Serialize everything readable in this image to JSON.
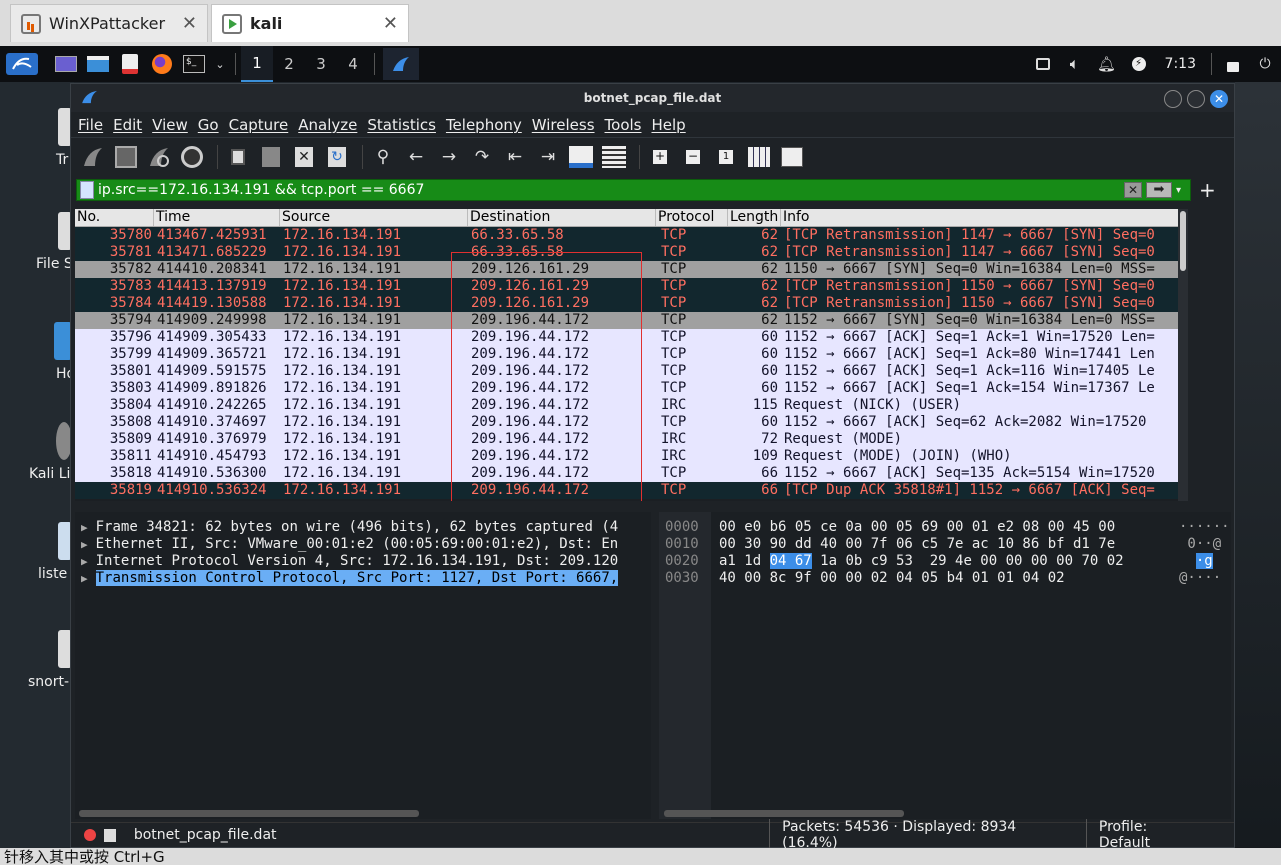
{
  "host_tabs": [
    {
      "label": "WinXPattacker",
      "close": "✕"
    },
    {
      "label": "kali",
      "close": "✕"
    }
  ],
  "panel": {
    "workspaces": [
      "1",
      "2",
      "3",
      "4"
    ],
    "active_workspace": "1",
    "clock": "7:13"
  },
  "desktop_icons": [
    "Tr",
    "File S",
    "Ho",
    "Kali Li",
    "liste",
    "snort-"
  ],
  "window": {
    "title": "botnet_pcap_file.dat"
  },
  "menu": [
    "File",
    "Edit",
    "View",
    "Go",
    "Capture",
    "Analyze",
    "Statistics",
    "Telephony",
    "Wireless",
    "Tools",
    "Help"
  ],
  "filter": {
    "value": "ip.src==172.16.134.191 && tcp.port == 6667",
    "apply_icon": "➡",
    "clear_icon": "✕",
    "add_icon": "+"
  },
  "columns": [
    "No.",
    "Time",
    "Source",
    "Destination",
    "Protocol",
    "Length",
    "Info"
  ],
  "packets": [
    {
      "no": "35780",
      "time": "413467.425931",
      "src": "172.16.134.191",
      "dst": "66.33.65.58",
      "proto": "TCP",
      "len": "62",
      "info": "[TCP Retransmission] 1147 → 6667 [SYN] Seq=0",
      "style": "dark"
    },
    {
      "no": "35781",
      "time": "413471.685229",
      "src": "172.16.134.191",
      "dst": "66.33.65.58",
      "proto": "TCP",
      "len": "62",
      "info": "[TCP Retransmission] 1147 → 6667 [SYN] Seq=0",
      "style": "dark"
    },
    {
      "no": "35782",
      "time": "414410.208341",
      "src": "172.16.134.191",
      "dst": "209.126.161.29",
      "proto": "TCP",
      "len": "62",
      "info": "1150 → 6667 [SYN] Seq=0 Win=16384 Len=0 MSS=",
      "style": "gray"
    },
    {
      "no": "35783",
      "time": "414413.137919",
      "src": "172.16.134.191",
      "dst": "209.126.161.29",
      "proto": "TCP",
      "len": "62",
      "info": "[TCP Retransmission] 1150 → 6667 [SYN] Seq=0",
      "style": "dark"
    },
    {
      "no": "35784",
      "time": "414419.130588",
      "src": "172.16.134.191",
      "dst": "209.126.161.29",
      "proto": "TCP",
      "len": "62",
      "info": "[TCP Retransmission] 1150 → 6667 [SYN] Seq=0",
      "style": "dark"
    },
    {
      "no": "35794",
      "time": "414909.249998",
      "src": "172.16.134.191",
      "dst": "209.196.44.172",
      "proto": "TCP",
      "len": "62",
      "info": "1152 → 6667 [SYN] Seq=0 Win=16384 Len=0 MSS=",
      "style": "gray"
    },
    {
      "no": "35796",
      "time": "414909.305433",
      "src": "172.16.134.191",
      "dst": "209.196.44.172",
      "proto": "TCP",
      "len": "60",
      "info": "1152 → 6667 [ACK] Seq=1 Ack=1 Win=17520 Len=",
      "style": "light"
    },
    {
      "no": "35799",
      "time": "414909.365721",
      "src": "172.16.134.191",
      "dst": "209.196.44.172",
      "proto": "TCP",
      "len": "60",
      "info": "1152 → 6667 [ACK] Seq=1 Ack=80 Win=17441 Len",
      "style": "light"
    },
    {
      "no": "35801",
      "time": "414909.591575",
      "src": "172.16.134.191",
      "dst": "209.196.44.172",
      "proto": "TCP",
      "len": "60",
      "info": "1152 → 6667 [ACK] Seq=1 Ack=116 Win=17405 Le",
      "style": "light"
    },
    {
      "no": "35803",
      "time": "414909.891826",
      "src": "172.16.134.191",
      "dst": "209.196.44.172",
      "proto": "TCP",
      "len": "60",
      "info": "1152 → 6667 [ACK] Seq=1 Ack=154 Win=17367 Le",
      "style": "light"
    },
    {
      "no": "35804",
      "time": "414910.242265",
      "src": "172.16.134.191",
      "dst": "209.196.44.172",
      "proto": "IRC",
      "len": "115",
      "info": "Request (NICK) (USER)",
      "style": "light"
    },
    {
      "no": "35808",
      "time": "414910.374697",
      "src": "172.16.134.191",
      "dst": "209.196.44.172",
      "proto": "TCP",
      "len": "60",
      "info": "1152 → 6667 [ACK] Seq=62 Ack=2082 Win=17520",
      "style": "light"
    },
    {
      "no": "35809",
      "time": "414910.376979",
      "src": "172.16.134.191",
      "dst": "209.196.44.172",
      "proto": "IRC",
      "len": "72",
      "info": "Request (MODE)",
      "style": "light"
    },
    {
      "no": "35811",
      "time": "414910.454793",
      "src": "172.16.134.191",
      "dst": "209.196.44.172",
      "proto": "IRC",
      "len": "109",
      "info": "Request (MODE) (JOIN) (WHO)",
      "style": "light"
    },
    {
      "no": "35818",
      "time": "414910.536300",
      "src": "172.16.134.191",
      "dst": "209.196.44.172",
      "proto": "TCP",
      "len": "66",
      "info": "1152 → 6667 [ACK] Seq=135 Ack=5154 Win=17520",
      "style": "light"
    },
    {
      "no": "35819",
      "time": "414910.536324",
      "src": "172.16.134.191",
      "dst": "209.196.44.172",
      "proto": "TCP",
      "len": "66",
      "info": "[TCP Dup ACK 35818#1] 1152 → 6667 [ACK] Seq=",
      "style": "dark"
    }
  ],
  "details": [
    {
      "text": "Frame 34821: 62 bytes on wire (496 bits), 62 bytes captured (4",
      "selected": false
    },
    {
      "text": "Ethernet II, Src: VMware_00:01:e2 (00:05:69:00:01:e2), Dst: En",
      "selected": false
    },
    {
      "text": "Internet Protocol Version 4, Src: 172.16.134.191, Dst: 209.120",
      "selected": false
    },
    {
      "text": "Transmission Control Protocol, Src Port: 1127, Dst Port: 6667,",
      "selected": true
    }
  ],
  "bytes": [
    {
      "off": "0000",
      "hex_pre": "00 e0 b6 05 ce 0a 00 05  69 00 01 e2 08 00 45 00",
      "hl": "",
      "hex_post": "",
      "ascii_pre": "······",
      "ascii_hl": "",
      "ascii_post": ""
    },
    {
      "off": "0010",
      "hex_pre": "00 30 90 dd 40 00 7f 06  c5 7e ac 10 86 bf d1 7e",
      "hl": "",
      "hex_post": "",
      "ascii_pre": " 0··@",
      "ascii_hl": "",
      "ascii_post": ""
    },
    {
      "off": "0020",
      "hex_pre": "a1 1d ",
      "hl": "04 67",
      "hex_post": " 1a 0b c9 53  29 4e 00 00 00 00 70 02",
      "ascii_pre": "  ",
      "ascii_hl": "·g",
      "ascii_post": ""
    },
    {
      "off": "0030",
      "hex_pre": "40 00 8c 9f 00 00 02 04  05 b4 01 01 04 02",
      "hl": "",
      "hex_post": "",
      "ascii_pre": "@····",
      "ascii_hl": "",
      "ascii_post": ""
    }
  ],
  "status": {
    "file": "botnet_pcap_file.dat",
    "packets": "Packets: 54536 · Displayed: 8934 (16.4%)",
    "profile": "Profile: Default"
  },
  "host_bottom": "针移入其中或按 Ctrl+G",
  "colors": {
    "filter_valid": "#178b17",
    "row_dark_bg": "#12272e",
    "row_dark_fg": "#ff6f61",
    "row_gray_bg": "#a0a0a0",
    "row_light_bg": "#e7e6ff",
    "highlight_box": "#e03030",
    "selection": "#6aaef5"
  }
}
